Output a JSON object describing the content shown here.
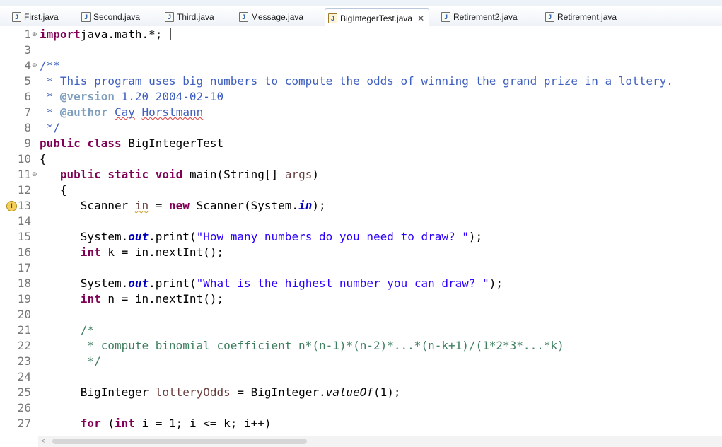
{
  "tabs": [
    {
      "label": "First.java",
      "active": false
    },
    {
      "label": "Second.java",
      "active": false
    },
    {
      "label": "Third.java",
      "active": false
    },
    {
      "label": "Message.java",
      "active": false
    },
    {
      "label": "BigIntegerTest.java",
      "active": true,
      "close_icon": "✕"
    },
    {
      "label": "Retirement2.java",
      "active": false
    },
    {
      "label": "Retirement.java",
      "active": false
    }
  ],
  "file_icon_letter": "J",
  "editor": {
    "lines": [
      {
        "n": "1",
        "fold": "⊕",
        "segs": [
          [
            "kw",
            "import"
          ],
          [
            "",
            "java.math.*;"
          ]
        ],
        "caret": true
      },
      {
        "n": "3",
        "segs": []
      },
      {
        "n": "4",
        "fold": "⊖",
        "segs": [
          [
            "jd",
            "/**"
          ]
        ]
      },
      {
        "n": "5",
        "segs": [
          [
            "jd",
            " * This program uses big numbers to compute the odds of winning the grand prize in a lottery."
          ]
        ]
      },
      {
        "n": "6",
        "segs": [
          [
            "jd",
            " * "
          ],
          [
            "jtag",
            "@version"
          ],
          [
            "jd",
            " 1.20 2004-02-10"
          ]
        ]
      },
      {
        "n": "7",
        "segs": [
          [
            "jd",
            " * "
          ],
          [
            "jtag",
            "@author"
          ],
          [
            "jd",
            " "
          ],
          [
            "jd spellul",
            "Cay"
          ],
          [
            "jd",
            " "
          ],
          [
            "jd spellul",
            "Horstmann"
          ]
        ]
      },
      {
        "n": "8",
        "segs": [
          [
            "jd",
            " */"
          ]
        ]
      },
      {
        "n": "9",
        "segs": [
          [
            "kw",
            "public"
          ],
          [
            "",
            " "
          ],
          [
            "kw",
            "class"
          ],
          [
            "",
            " BigIntegerTest"
          ]
        ]
      },
      {
        "n": "10",
        "segs": [
          [
            "",
            "{"
          ]
        ]
      },
      {
        "n": "11",
        "fold": "⊖",
        "segs": [
          [
            "",
            "   "
          ],
          [
            "kw",
            "public"
          ],
          [
            "",
            " "
          ],
          [
            "kw",
            "static"
          ],
          [
            "",
            " "
          ],
          [
            "kw",
            "void"
          ],
          [
            "",
            " main(String[] "
          ],
          [
            "var",
            "args"
          ],
          [
            "",
            ")"
          ]
        ]
      },
      {
        "n": "12",
        "segs": [
          [
            "",
            "   {"
          ]
        ]
      },
      {
        "n": "13",
        "warn": true,
        "segs": [
          [
            "",
            "      Scanner "
          ],
          [
            "var warnul",
            "in"
          ],
          [
            "",
            " = "
          ],
          [
            "kw",
            "new"
          ],
          [
            "",
            " Scanner(System."
          ],
          [
            "fld",
            "in"
          ],
          [
            "",
            ");"
          ]
        ]
      },
      {
        "n": "14",
        "segs": []
      },
      {
        "n": "15",
        "segs": [
          [
            "",
            "      System."
          ],
          [
            "fld",
            "out"
          ],
          [
            "",
            ".print("
          ],
          [
            "str",
            "\"How many numbers do you need to draw? \""
          ],
          [
            "",
            ");"
          ]
        ]
      },
      {
        "n": "16",
        "segs": [
          [
            "",
            "      "
          ],
          [
            "kw",
            "int"
          ],
          [
            "",
            " k = in.nextInt();"
          ]
        ]
      },
      {
        "n": "17",
        "segs": []
      },
      {
        "n": "18",
        "segs": [
          [
            "",
            "      System."
          ],
          [
            "fld",
            "out"
          ],
          [
            "",
            ".print("
          ],
          [
            "str",
            "\"What is the highest number you can draw? \""
          ],
          [
            "",
            ");"
          ]
        ]
      },
      {
        "n": "19",
        "segs": [
          [
            "",
            "      "
          ],
          [
            "kw",
            "int"
          ],
          [
            "",
            " n = in.nextInt();"
          ]
        ]
      },
      {
        "n": "20",
        "segs": []
      },
      {
        "n": "21",
        "segs": [
          [
            "cm",
            "      /*"
          ]
        ]
      },
      {
        "n": "22",
        "segs": [
          [
            "cm",
            "       * compute binomial coefficient n*(n-1)*(n-2)*...*(n-k+1)/(1*2*3*...*k)"
          ]
        ]
      },
      {
        "n": "23",
        "segs": [
          [
            "cm",
            "       */"
          ]
        ]
      },
      {
        "n": "24",
        "segs": []
      },
      {
        "n": "25",
        "segs": [
          [
            "",
            "      BigInteger "
          ],
          [
            "var",
            "lotteryOdds"
          ],
          [
            "",
            " = BigInteger."
          ],
          [
            "it",
            "valueOf"
          ],
          [
            "",
            "(1);"
          ]
        ]
      },
      {
        "n": "26",
        "segs": []
      },
      {
        "n": "27",
        "segs": [
          [
            "",
            "      "
          ],
          [
            "kw",
            "for"
          ],
          [
            "",
            " ("
          ],
          [
            "kw",
            "int"
          ],
          [
            "",
            " i = 1; i <= k; i++)"
          ]
        ]
      }
    ]
  },
  "scrollbar": {
    "left_arrow": "<"
  },
  "colors": {
    "keyword": "#7f0055",
    "comment": "#3f7f5f",
    "javadoc": "#3f5fbf",
    "javadoc_tag": "#7f9fbf",
    "string": "#2a00ff",
    "field": "#0000c0",
    "local_var": "#6a3e3e"
  }
}
